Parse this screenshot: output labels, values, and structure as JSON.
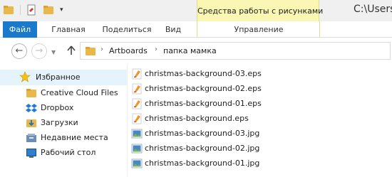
{
  "window": {
    "title_path": "C:\\Users\\",
    "contextual_tab_group": "Средства работы с рисунками"
  },
  "ribbon": {
    "tabs": [
      {
        "label": "Файл",
        "active": true
      },
      {
        "label": "Главная"
      },
      {
        "label": "Поделиться"
      },
      {
        "label": "Вид"
      },
      {
        "label": "Управление"
      }
    ]
  },
  "address": {
    "breadcrumb": [
      "Artboards",
      "папка мамка"
    ]
  },
  "navigation_pane": {
    "favorites_label": "Избранное",
    "items": [
      {
        "label": "Creative Cloud Files",
        "icon": "folder-icon"
      },
      {
        "label": "Dropbox",
        "icon": "dropbox-icon"
      },
      {
        "label": "Загрузки",
        "icon": "downloads-icon"
      },
      {
        "label": "Недавние места",
        "icon": "recent-places-icon"
      },
      {
        "label": "Рабочий стол",
        "icon": "desktop-icon"
      }
    ]
  },
  "files": [
    {
      "name": "christmas-background-03.eps",
      "type": "eps"
    },
    {
      "name": "christmas-background-02.eps",
      "type": "eps"
    },
    {
      "name": "christmas-background-01.eps",
      "type": "eps"
    },
    {
      "name": "christmas-background.eps",
      "type": "eps"
    },
    {
      "name": "christmas-background-03.jpg",
      "type": "jpg"
    },
    {
      "name": "christmas-background-02.jpg",
      "type": "jpg"
    },
    {
      "name": "christmas-background-01.jpg",
      "type": "jpg"
    }
  ],
  "colors": {
    "file_tab": "#1979ca",
    "contextual_tab": "#faf6b4",
    "selection": "#e5f3fb",
    "folder": "#e8b84a"
  }
}
